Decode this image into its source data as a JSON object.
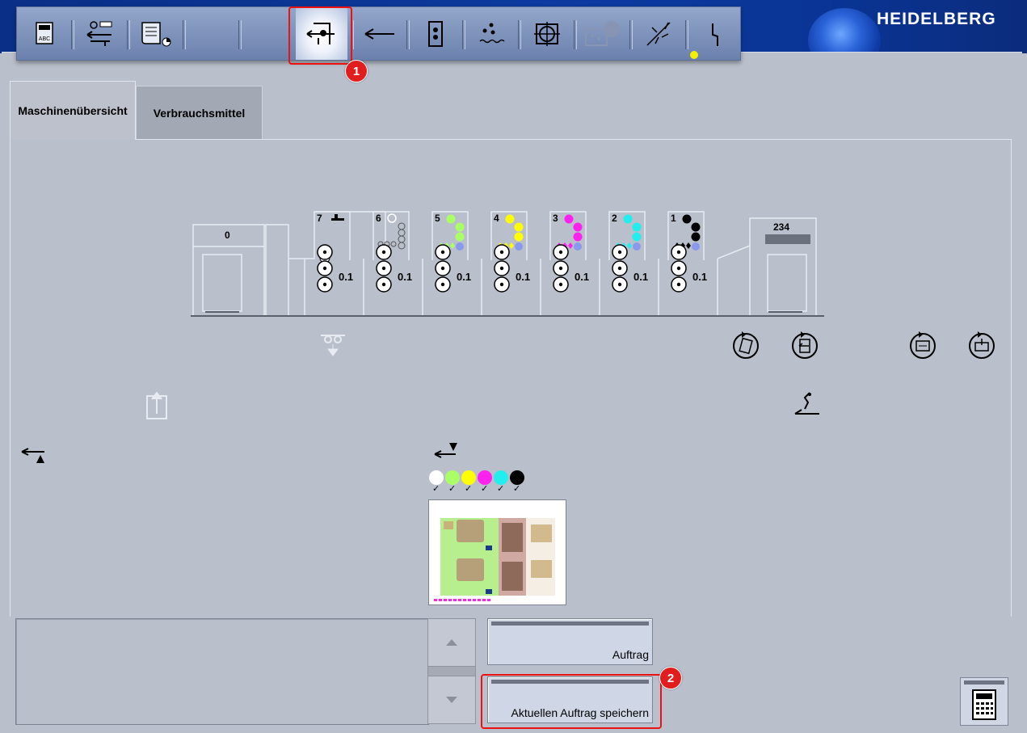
{
  "brand": {
    "name": "HEIDELBERG"
  },
  "toolbar": {
    "buttons": [
      {
        "name": "job-abc-icon",
        "active": false
      },
      {
        "name": "job-transfer-icon",
        "active": false
      },
      {
        "name": "job-list-icon",
        "active": false
      },
      {
        "name": "empty-slot-1",
        "active": false
      },
      {
        "name": "empty-slot-2",
        "active": false
      },
      {
        "name": "feeder-adjust-icon",
        "active": true
      },
      {
        "name": "sheet-travel-icon",
        "active": false
      },
      {
        "name": "printing-unit-icon",
        "active": false
      },
      {
        "name": "dampening-icon",
        "active": false
      },
      {
        "name": "register-target-icon",
        "active": false
      },
      {
        "name": "color-measure-icon",
        "active": false
      },
      {
        "name": "wash-spray-icon",
        "active": false
      },
      {
        "name": "power-icon",
        "active": false
      }
    ],
    "status_dot_color": "#f5f000"
  },
  "annotations": {
    "badge1": "1",
    "badge2": "2",
    "color": "#e11d1d"
  },
  "tabs": [
    {
      "label": "Maschinenübersicht",
      "active": true
    },
    {
      "label": "Verbrauchsmittel",
      "active": false
    }
  ],
  "press": {
    "feeder_label": "0",
    "delivery_label": "234",
    "units": [
      {
        "number": "7",
        "value": "0.1",
        "colors": [
          "#ffffff"
        ]
      },
      {
        "number": "6",
        "value": "0.1",
        "colors": [
          "#ffffff"
        ]
      },
      {
        "number": "5",
        "value": "0.1",
        "colors": [
          "#aaff66"
        ]
      },
      {
        "number": "4",
        "value": "0.1",
        "colors": [
          "#ffff00"
        ]
      },
      {
        "number": "3",
        "value": "0.1",
        "colors": [
          "#ff22ee"
        ]
      },
      {
        "number": "2",
        "value": "0.1",
        "colors": [
          "#22eeee"
        ]
      },
      {
        "number": "1",
        "value": "0.1",
        "colors": [
          "#000000"
        ]
      }
    ]
  },
  "ink_sequence": [
    {
      "color": "#ffffff",
      "check": "✓"
    },
    {
      "color": "#aaff66",
      "check": "✓"
    },
    {
      "color": "#ffff00",
      "check": "✓"
    },
    {
      "color": "#ff22ee",
      "check": "✓"
    },
    {
      "color": "#22eeee",
      "check": "✓"
    },
    {
      "color": "#000000",
      "check": "✓"
    }
  ],
  "buttons": {
    "order_label": "Auftrag",
    "save_label": "Aktuellen Auftrag speichern"
  }
}
